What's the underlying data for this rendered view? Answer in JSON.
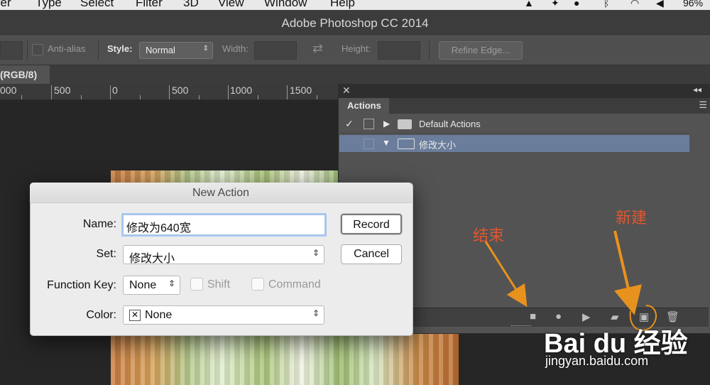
{
  "menubar": {
    "items": [
      "yer",
      "Type",
      "Select",
      "Filter",
      "3D",
      "View",
      "Window",
      "Help"
    ],
    "battery": "96%"
  },
  "window": {
    "title": "Adobe Photoshop CC 2014"
  },
  "options_bar": {
    "antialias_label": "Anti-alias",
    "style_label": "Style:",
    "style_value": "Normal",
    "width_label": "Width:",
    "height_label": "Height:",
    "refine_edge_label": "Refine Edge..."
  },
  "document": {
    "tab_label": "(RGB/8)",
    "ruler_labels": [
      "000",
      "500",
      "0",
      "500",
      "1000",
      "1500"
    ]
  },
  "actions_panel": {
    "tab_label": "Actions",
    "sets": [
      {
        "name": "Default Actions",
        "expanded": false,
        "checked": true
      },
      {
        "name": "修改大小",
        "expanded": true,
        "checked": false,
        "selected": true
      }
    ]
  },
  "new_action_dialog": {
    "title": "New Action",
    "name_label": "Name:",
    "name_value": "修改为640宽",
    "set_label": "Set:",
    "set_value": "修改大小",
    "function_key_label": "Function Key:",
    "function_key_value": "None",
    "shift_label": "Shift",
    "command_label": "Command",
    "color_label": "Color:",
    "color_value": "None",
    "record_label": "Record",
    "cancel_label": "Cancel"
  },
  "annotations": {
    "end_label": "结束",
    "new_label": "新建"
  },
  "watermark": {
    "logo_text": "Bai du 经验",
    "url": "jingyan.baidu.com"
  },
  "colors": {
    "annotation_text": "#e0572f",
    "annotation_arrow": "#e8921e",
    "selected_row": "#6a7d9b",
    "focus_ring": "#a8c8f2"
  }
}
